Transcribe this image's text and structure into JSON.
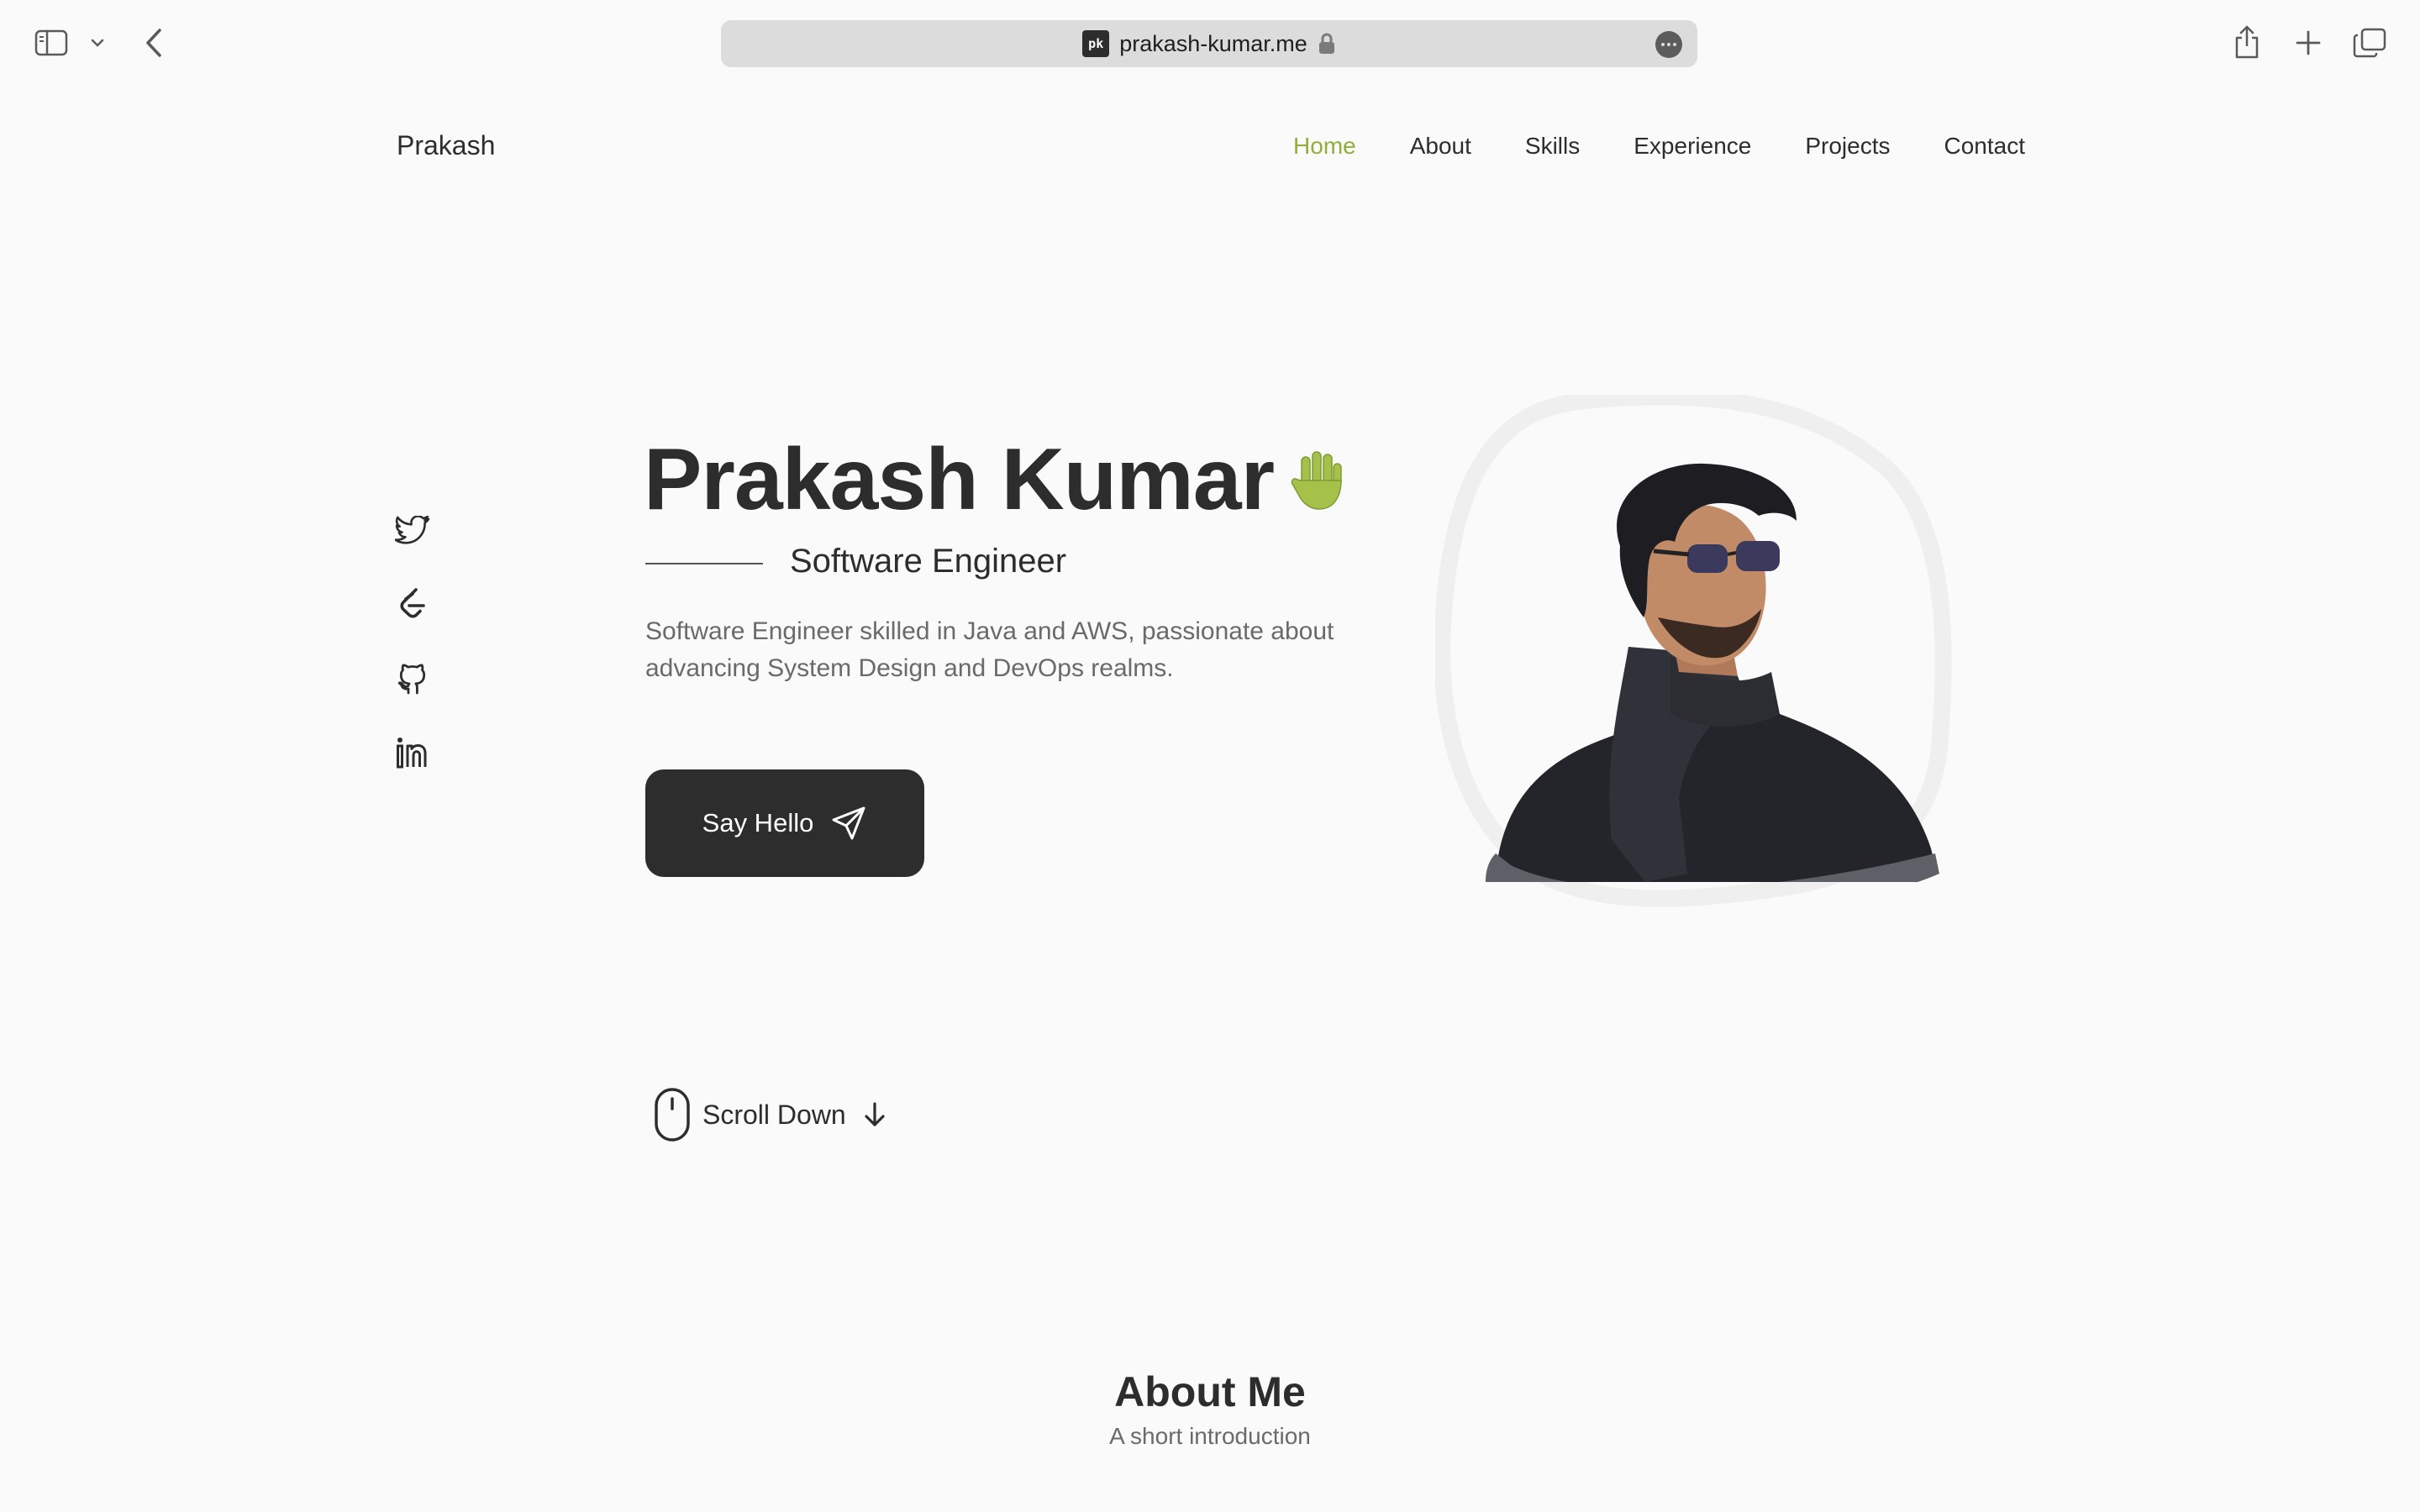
{
  "browser": {
    "url": "prakash-kumar.me",
    "favicon_text": "pk"
  },
  "header": {
    "brand": "Prakash",
    "nav": [
      "Home",
      "About",
      "Skills",
      "Experience",
      "Projects",
      "Contact"
    ],
    "active_nav": "Home",
    "accent_color": "#8fae3c"
  },
  "social": [
    "twitter-icon",
    "leetcode-icon",
    "github-icon",
    "linkedin-icon"
  ],
  "hero": {
    "name": "Prakash Kumar",
    "title": "Software Engineer",
    "description": "Software Engineer skilled in Java and AWS, passionate about advancing System Design and DevOps realms.",
    "cta": "Say Hello",
    "scroll": "Scroll Down"
  },
  "about": {
    "title": "About Me",
    "subtitle": "A short introduction"
  }
}
